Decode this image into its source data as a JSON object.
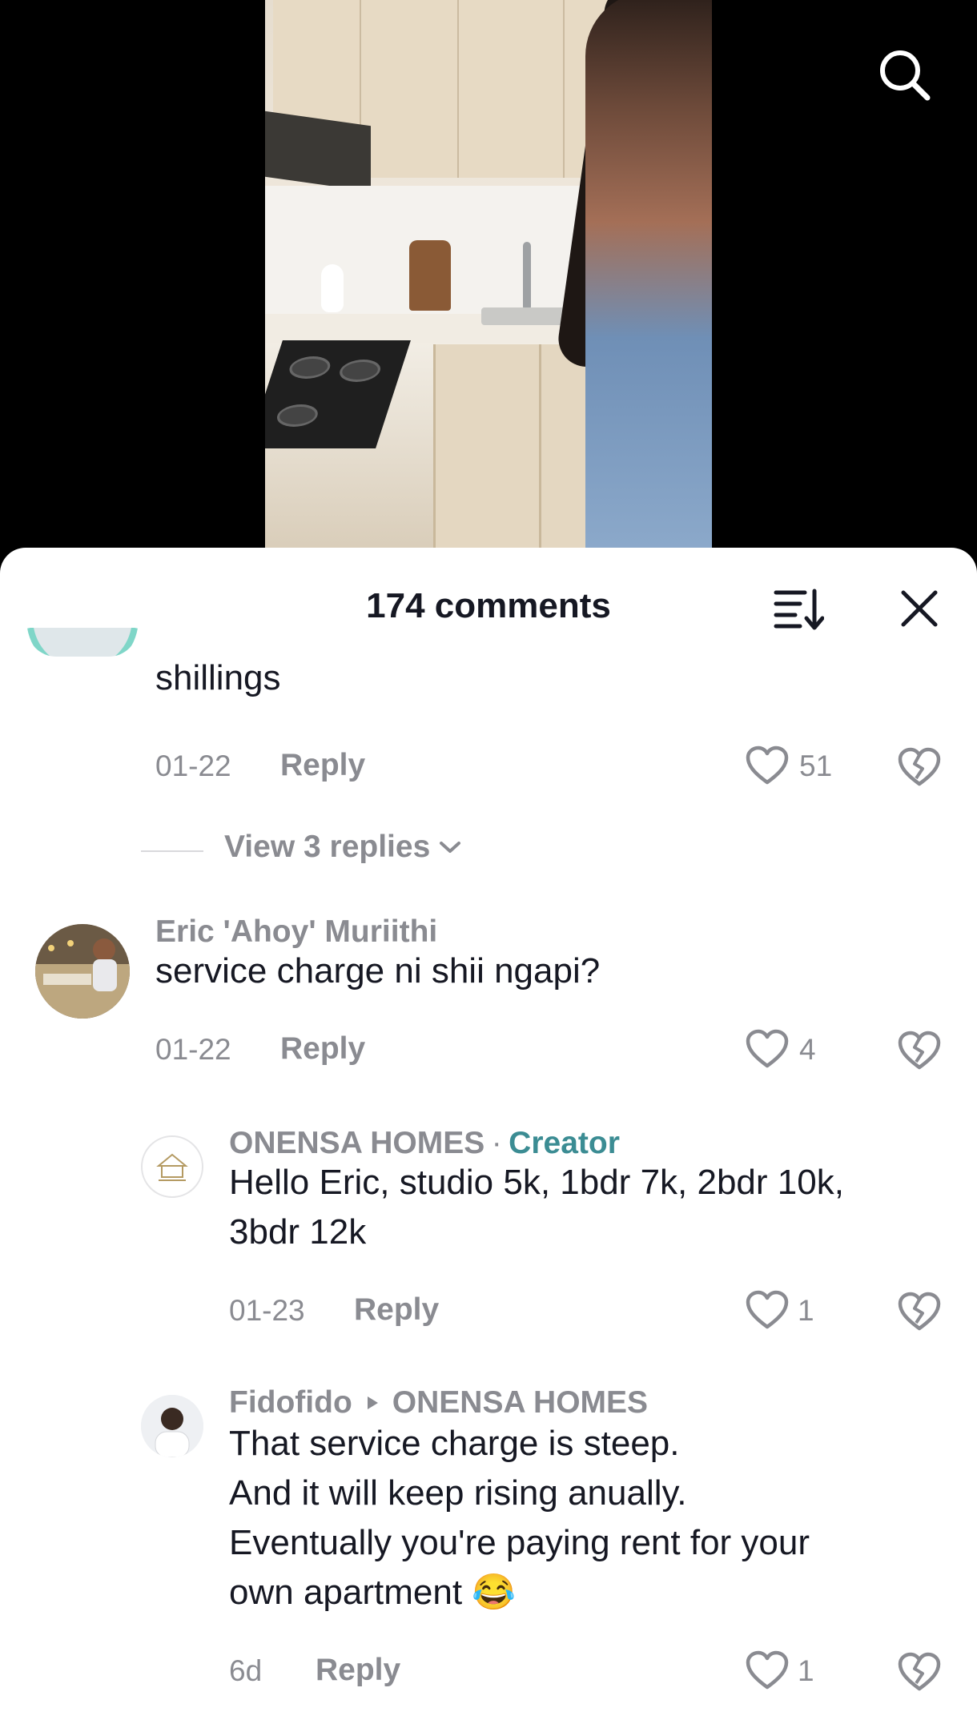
{
  "header": {
    "comments_count_label": "174 comments"
  },
  "icons": {
    "search": "search-icon",
    "sort": "sort-icon",
    "close": "close-icon",
    "like": "heart-icon",
    "dislike": "broken-heart-icon",
    "chevron": "chevron-down-icon",
    "arrow": "triangle-right-icon"
  },
  "colors": {
    "creator_accent": "#3b8c93",
    "muted_text": "#8a8b91",
    "primary_text": "#161823"
  },
  "comments": [
    {
      "text_tail": "shillings",
      "date": "01-22",
      "reply_label": "Reply",
      "likes": "51",
      "view_replies_label": "View 3 replies"
    },
    {
      "username": "Eric 'Ahoy' Muriithi",
      "text": "service charge ni shii ngapi?",
      "date": "01-22",
      "reply_label": "Reply",
      "likes": "4"
    }
  ],
  "replies": [
    {
      "username": "ONENSA HOMES",
      "separator": "·",
      "creator_label": "Creator",
      "text_line1": "Hello Eric, studio 5k, 1bdr 7k, 2bdr 10k,",
      "text_line2": "3bdr 12k",
      "date": "01-23",
      "reply_label": "Reply",
      "likes": "1"
    },
    {
      "username": "Fidofido",
      "reply_to": "ONENSA HOMES",
      "text_line1": "That service charge is steep.",
      "text_line2": "And it will keep rising anually.",
      "text_line3": "Eventually you're paying rent for your",
      "text_line4": "own apartment 😂",
      "date": "6d",
      "reply_label": "Reply",
      "likes": "1"
    }
  ]
}
